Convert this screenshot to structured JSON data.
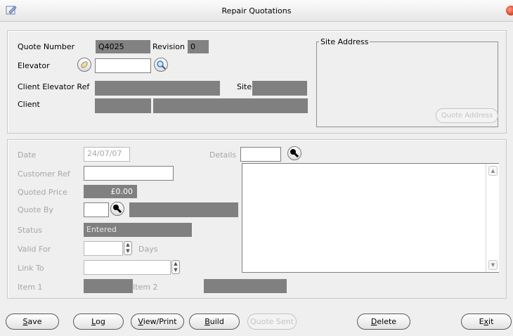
{
  "window": {
    "title": "Repair Quotations"
  },
  "header": {
    "quote_number_label": "Quote Number",
    "quote_number_value": "Q4025",
    "revision_label": "Revision",
    "revision_value": "0",
    "elevator_label": "Elevator",
    "elevator_value": "",
    "client_elevator_ref_label": "Client Elevator Ref",
    "client_elevator_ref_value": "",
    "site_label": "Site",
    "site_value": "",
    "client_label": "Client",
    "client_code_value": "",
    "client_name_value": "",
    "site_address_legend": "Site Address",
    "quote_address_button": "Quote Address"
  },
  "details": {
    "date_label": "Date",
    "date_value": "24/07/07",
    "details_label": "Details",
    "details_value": "",
    "customer_ref_label": "Customer Ref",
    "customer_ref_value": "",
    "quoted_price_label": "Quoted Price",
    "quoted_price_value": "£0.00",
    "quote_by_label": "Quote By",
    "quote_by_code": "",
    "quote_by_name": "",
    "status_label": "Status",
    "status_value": "Entered",
    "valid_for_label": "Valid For",
    "valid_for_value": "",
    "valid_for_unit": "Days",
    "link_to_label": "Link To",
    "link_to_value": "",
    "item1_label": "Item 1",
    "item1_value": "",
    "item2_label": "Item 2",
    "item2_value": "",
    "notes_text": ""
  },
  "buttons": {
    "save": {
      "accel": "S",
      "rest": "ave"
    },
    "log": {
      "accel": "L",
      "rest": "og"
    },
    "view_print": {
      "accel": "V",
      "rest": "iew/Print"
    },
    "build": {
      "accel": "B",
      "rest": "uild"
    },
    "quote_sent": "Quote Sent",
    "delete": {
      "accel": "D",
      "rest": "elete"
    },
    "exit": {
      "pre": "E",
      "accel": "x",
      "rest": "it"
    }
  }
}
